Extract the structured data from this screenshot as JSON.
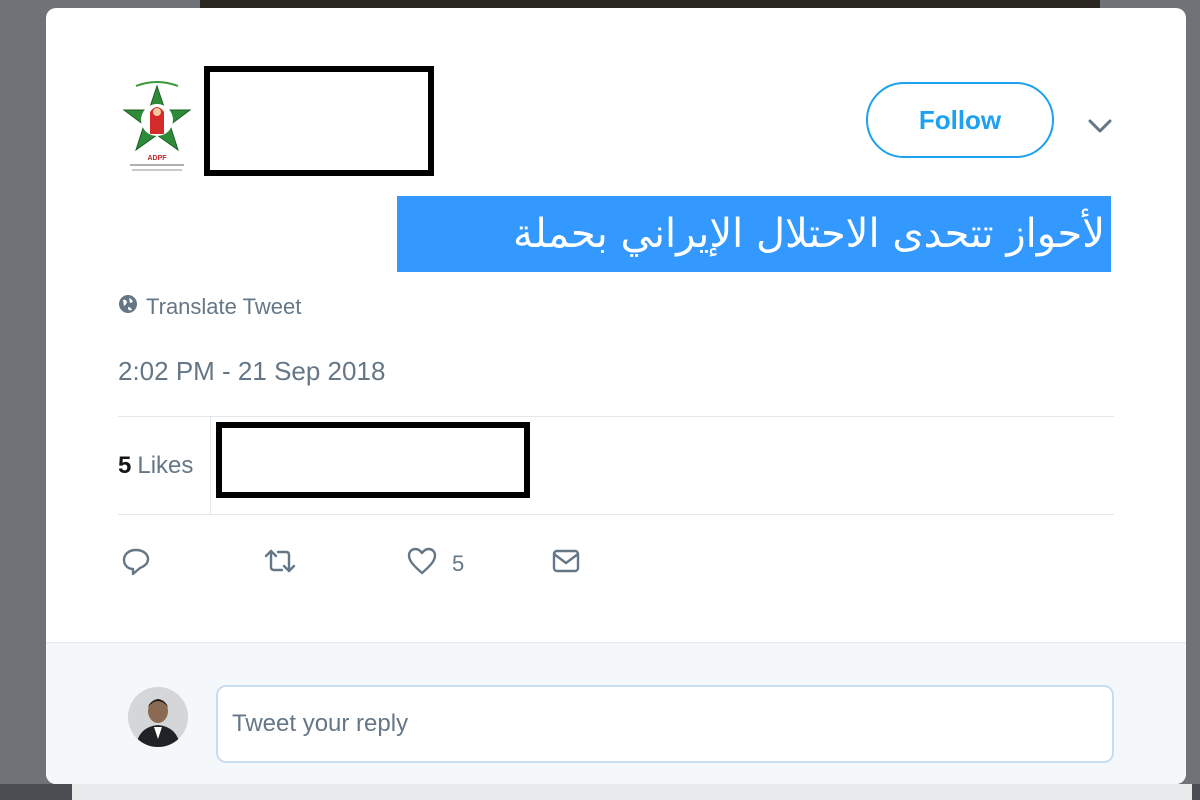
{
  "tweet": {
    "text": "لأحواز  تتحدى الاحتلال الإيراني بحملة",
    "translate_label": "Translate Tweet",
    "timestamp": "2:02 PM - 21 Sep 2018",
    "likes_count": "5",
    "likes_label": "Likes"
  },
  "header": {
    "follow_label": "Follow",
    "logo_text": "ADPF"
  },
  "actions": {
    "like_count": "5"
  },
  "reply": {
    "placeholder": "Tweet your reply"
  },
  "colors": {
    "accent": "#1da1f2",
    "selection": "#3399ff",
    "muted_text": "#657786"
  },
  "icons": [
    "globe-icon",
    "chevron-down-icon",
    "reply-icon",
    "retweet-icon",
    "heart-icon",
    "mail-icon"
  ]
}
